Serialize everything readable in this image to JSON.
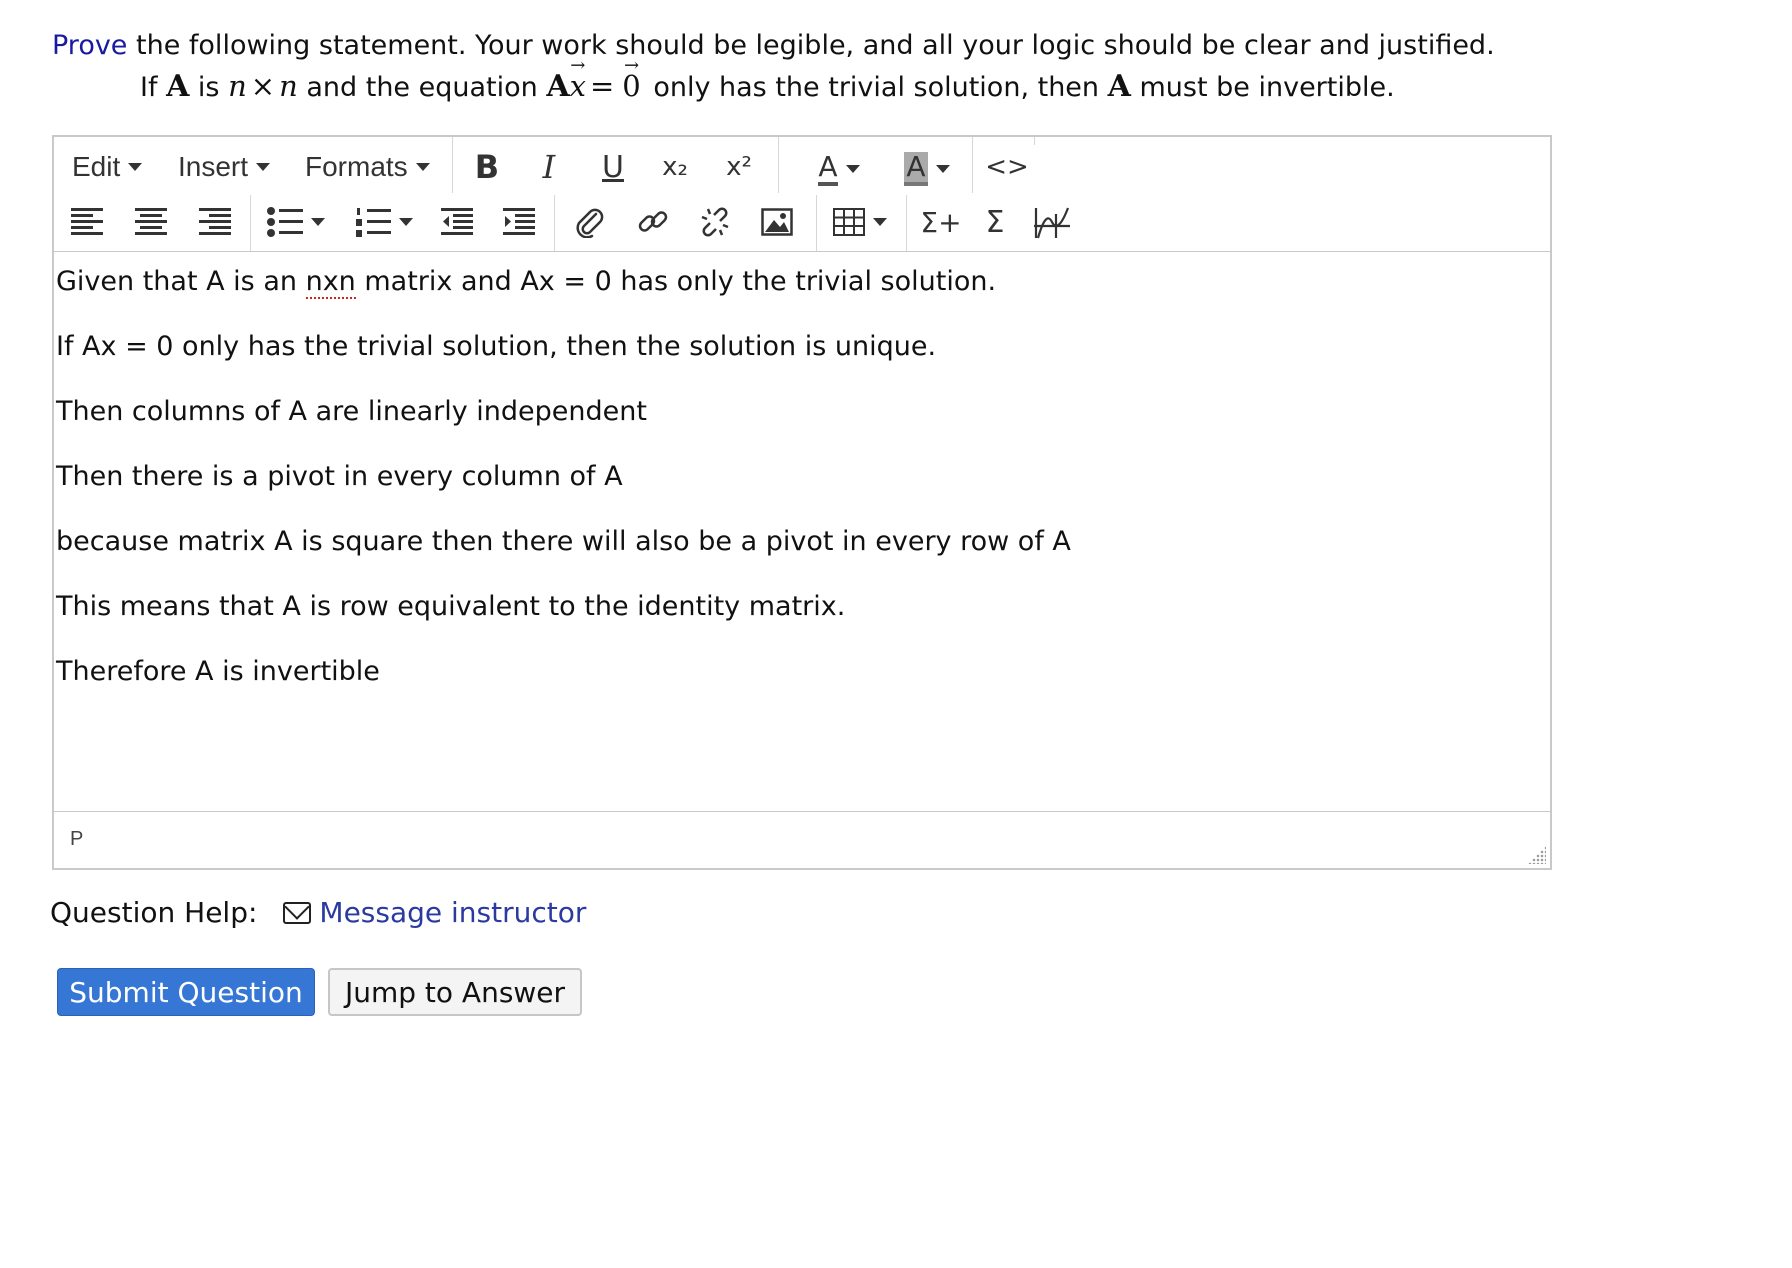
{
  "prompt": {
    "link_text": "Prove",
    "rest_text": " the following statement. Your work should be legible, and all your logic should be clear and justified."
  },
  "statement": {
    "p1": "If ",
    "A1": "A",
    "p2": " is ",
    "n1": "n",
    "times": "×",
    "n2": "n",
    "p3": " and the equation ",
    "A2": "A",
    "x": "x",
    "eq": "=",
    "zero": "0",
    "p4": " only has the trivial solution, then ",
    "A3": "A",
    "p5": " must be invertible."
  },
  "toolbar": {
    "menus": [
      "Edit",
      "Insert",
      "Formats"
    ],
    "bold": "B",
    "italic": "I",
    "underline": "U",
    "subscript": "x₂",
    "superscript": "x²",
    "text_color": "A",
    "bg_color": "A",
    "code": "<>",
    "sigma_plus": "Σ+",
    "sigma": "Σ"
  },
  "content": {
    "line1_a": "Given that A is an ",
    "line1_spell": "nxn",
    "line1_b": " matrix and Ax = 0 has only the trivial solution.",
    "lines": [
      "If Ax = 0 only has the trivial solution, then the solution is unique.",
      "Then columns of A are linearly independent",
      "Then there is a pivot in every column of A",
      "because matrix A is square then there will also be a pivot in every row of A",
      "This means that A is row equivalent to the identity matrix.",
      "Therefore A is invertible"
    ]
  },
  "statusbar": {
    "path": "P"
  },
  "help": {
    "label": "Question Help:",
    "message_link": "Message instructor"
  },
  "buttons": {
    "submit": "Submit Question",
    "jump": "Jump to Answer"
  },
  "colors": {
    "link": "#1a1aa0",
    "primary_button": "#3676d4",
    "spellcheck": "#d02020"
  }
}
